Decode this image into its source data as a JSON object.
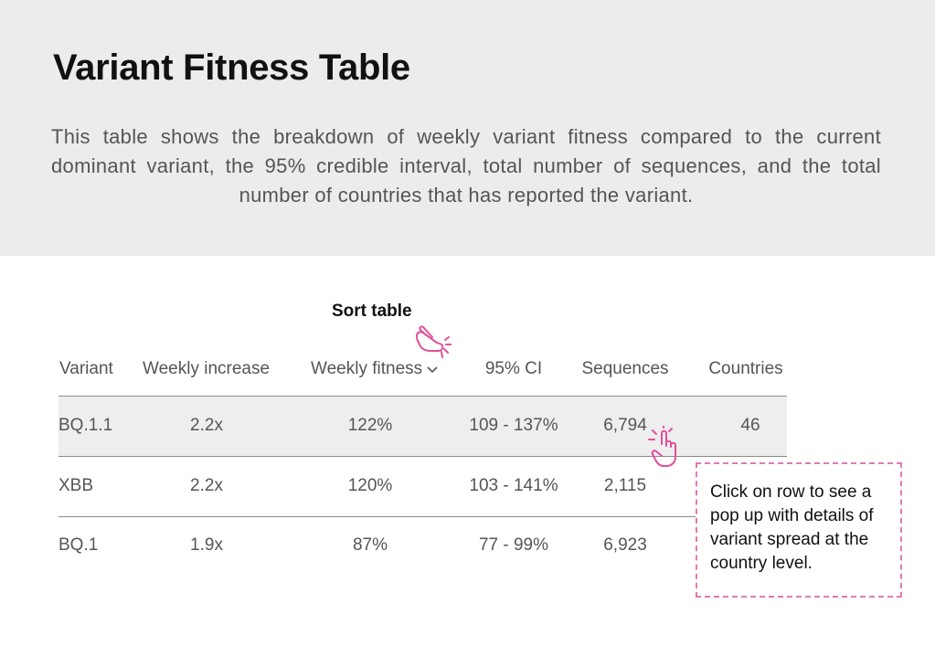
{
  "header": {
    "title": "Variant Fitness Table",
    "description": "This table shows the breakdown of weekly variant fitness compared to the current dominant variant, the 95% credible interval, total number of sequences, and the total number of countries that has reported the variant."
  },
  "sort_annotation": {
    "label": "Sort table",
    "icon": "pointing-hand-icon"
  },
  "table": {
    "columns": {
      "variant": "Variant",
      "weekly_increase": "Weekly increase",
      "weekly_fitness": "Weekly fitness",
      "ci": "95% CI",
      "sequences": "Sequences",
      "countries": "Countries"
    },
    "sort_indicator_icon": "chevron-down-icon",
    "rows": [
      {
        "variant": "BQ.1.1",
        "weekly_increase": "2.2x",
        "weekly_fitness": "122%",
        "ci": "109 - 137%",
        "sequences": "6,794",
        "countries": "46",
        "highlighted": true
      },
      {
        "variant": "XBB",
        "weekly_increase": "2.2x",
        "weekly_fitness": "120%",
        "ci": "103 - 141%",
        "sequences": "2,115",
        "countries": "",
        "highlighted": false
      },
      {
        "variant": "BQ.1",
        "weekly_increase": "1.9x",
        "weekly_fitness": "87%",
        "ci": "77 - 99%",
        "sequences": "6,923",
        "countries": "",
        "highlighted": false
      }
    ]
  },
  "callout": {
    "text": "Click on row to see a pop up with details of variant spread at the country level.",
    "icon": "pointing-hand-icon"
  },
  "colors": {
    "accent": "#e0509a",
    "header_bg": "#ececec",
    "row_highlight": "#eeeeee",
    "text_muted": "#555555",
    "text_dark": "#111111"
  }
}
